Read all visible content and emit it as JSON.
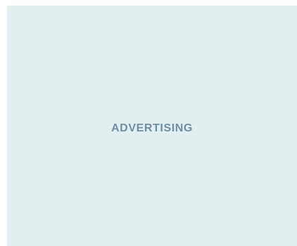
{
  "ad": {
    "label": "ADVERTISING"
  },
  "colors": {
    "ad_background": "#e2eff1",
    "ad_label": "#6e8fa3",
    "page_background": "#ffffff"
  }
}
